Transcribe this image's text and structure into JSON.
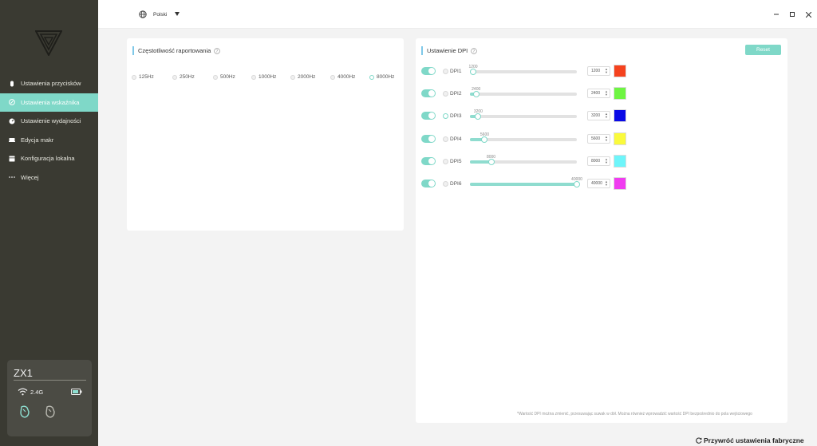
{
  "header": {
    "language": "Polski"
  },
  "sidebar": {
    "items": [
      {
        "label": "Ustawienia przycisków",
        "icon": "mouse-icon"
      },
      {
        "label": "Ustawienia wskaźnika",
        "icon": "pointer-icon"
      },
      {
        "label": "Ustawienie wydajności",
        "icon": "performance-icon"
      },
      {
        "label": "Edycja makr",
        "icon": "keyboard-icon"
      },
      {
        "label": "Konfiguracja lokalna",
        "icon": "config-icon"
      },
      {
        "label": "Więcej",
        "icon": "more-icon"
      }
    ],
    "active_index": 1
  },
  "device": {
    "name": "ZX1",
    "connection": "2.4G"
  },
  "report_rate": {
    "title": "Częstotliwość raportowania",
    "options": [
      "125Hz",
      "250Hz",
      "500Hz",
      "1000Hz",
      "2000Hz",
      "4000Hz",
      "8000Hz"
    ],
    "selected": "8000Hz"
  },
  "dpi": {
    "title": "Ustawienie DPI",
    "reset_label": "Reset",
    "range": [
      100,
      40000
    ],
    "selected": "DPI3",
    "rows": [
      {
        "label": "DPI1",
        "value": "1200",
        "color": "#f5421e",
        "enabled": true
      },
      {
        "label": "DPI2",
        "value": "2400",
        "color": "#6ef542",
        "enabled": true
      },
      {
        "label": "DPI3",
        "value": "3200",
        "color": "#0a0ae6",
        "enabled": true
      },
      {
        "label": "DPI4",
        "value": "5600",
        "color": "#fafa3c",
        "enabled": true
      },
      {
        "label": "DPI5",
        "value": "8000",
        "color": "#6ef5fa",
        "enabled": true
      },
      {
        "label": "DPI6",
        "value": "40000",
        "color": "#f03cf0",
        "enabled": true
      }
    ],
    "footnote": "*Wartość DPI można zmienić, przesuwając suwak w dół. Można również wprowadzić wartość DPI bezpośrednio do pola wejściowego"
  },
  "footer": {
    "factory_reset": "Przywróć ustawienia fabryczne"
  },
  "colors": {
    "accent": "#7fd8c8",
    "sidebar": "#3a3a32"
  }
}
